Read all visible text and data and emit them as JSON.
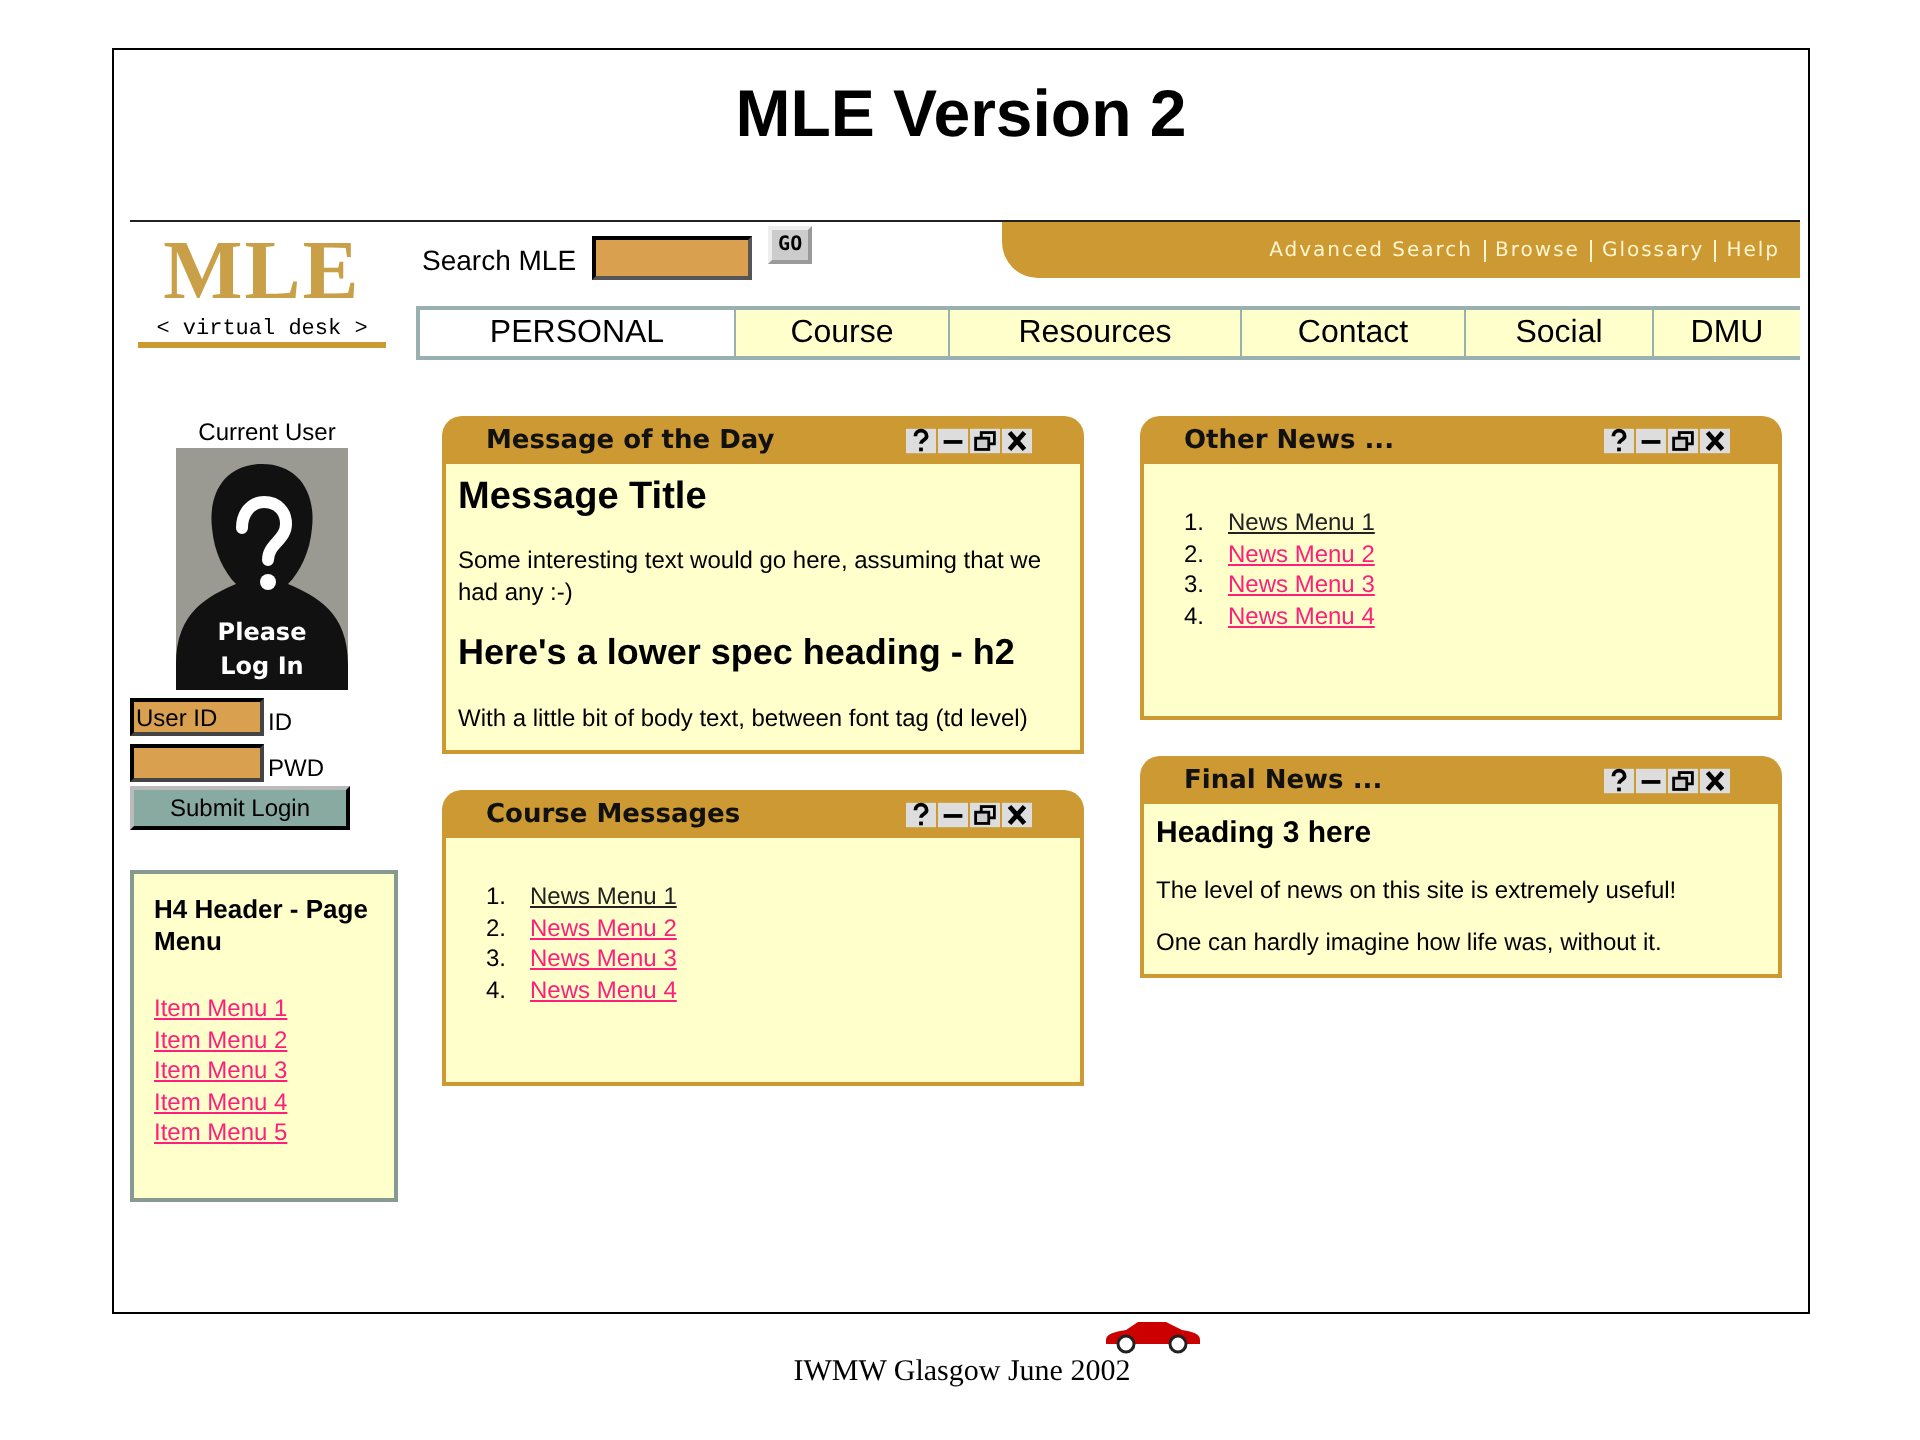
{
  "slide": {
    "title": "MLE Version 2",
    "footer": "IWMW Glasgow June 2002"
  },
  "logo": {
    "name": "MLE",
    "tagline": "< virtual desk >"
  },
  "search": {
    "label": "Search MLE",
    "button": "GO"
  },
  "top_links": [
    "Advanced Search",
    "Browse",
    "Glossary",
    "Help"
  ],
  "tabs": [
    {
      "label": "PERSONAL",
      "selected": true
    },
    {
      "label": "Course",
      "selected": false
    },
    {
      "label": "Resources",
      "selected": false
    },
    {
      "label": "Contact",
      "selected": false
    },
    {
      "label": "Social",
      "selected": false
    },
    {
      "label": "DMU",
      "selected": false
    }
  ],
  "login": {
    "caption": "Current User",
    "portrait_text": "Please Log In",
    "user_field": {
      "value": "User ID",
      "label": "ID"
    },
    "password_field": {
      "label": "PWD"
    },
    "button": "Submit Login"
  },
  "page_menu": {
    "heading": "H4 Header - Page Menu",
    "items": [
      "Item Menu 1",
      "Item Menu 2",
      "Item Menu 3",
      "Item Menu 4",
      "Item Menu 5"
    ]
  },
  "columns": [
    [
      {
        "title": "Message of the Day",
        "blocks": [
          {
            "kind": "h1",
            "text": "Message Title"
          },
          {
            "kind": "p",
            "text": "Some interesting text would go here, assuming that we had any :-)"
          },
          {
            "kind": "h2",
            "text": "Here's a lower spec heading - h2"
          },
          {
            "kind": "p",
            "text": "With a little bit of body text, between font tag (td level)"
          }
        ]
      },
      {
        "title": "Course Messages",
        "blocks": [
          {
            "kind": "list",
            "items": [
              {
                "number": "1.",
                "text": "News Menu 1",
                "visited": true
              },
              {
                "number": "2.",
                "text": "News Menu 2",
                "visited": false
              },
              {
                "number": "3.",
                "text": "News Menu 3",
                "visited": false
              },
              {
                "number": "4.",
                "text": "News Menu 4",
                "visited": false
              }
            ]
          }
        ]
      }
    ],
    [
      {
        "title": "Other News ...",
        "blocks": [
          {
            "kind": "list",
            "items": [
              {
                "number": "1.",
                "text": "News Menu 1",
                "visited": true
              },
              {
                "number": "2.",
                "text": "News Menu 2",
                "visited": false
              },
              {
                "number": "3.",
                "text": "News Menu 3",
                "visited": false
              },
              {
                "number": "4.",
                "text": "News Menu 4",
                "visited": false
              }
            ]
          }
        ]
      },
      {
        "title": "Final News ...",
        "blocks": [
          {
            "kind": "h3",
            "text": "Heading 3 here"
          },
          {
            "kind": "p",
            "text": "The level of news on this site is extremely useful!"
          },
          {
            "kind": "p",
            "text": "One can hardly imagine how life was, without it."
          }
        ]
      }
    ]
  ]
}
